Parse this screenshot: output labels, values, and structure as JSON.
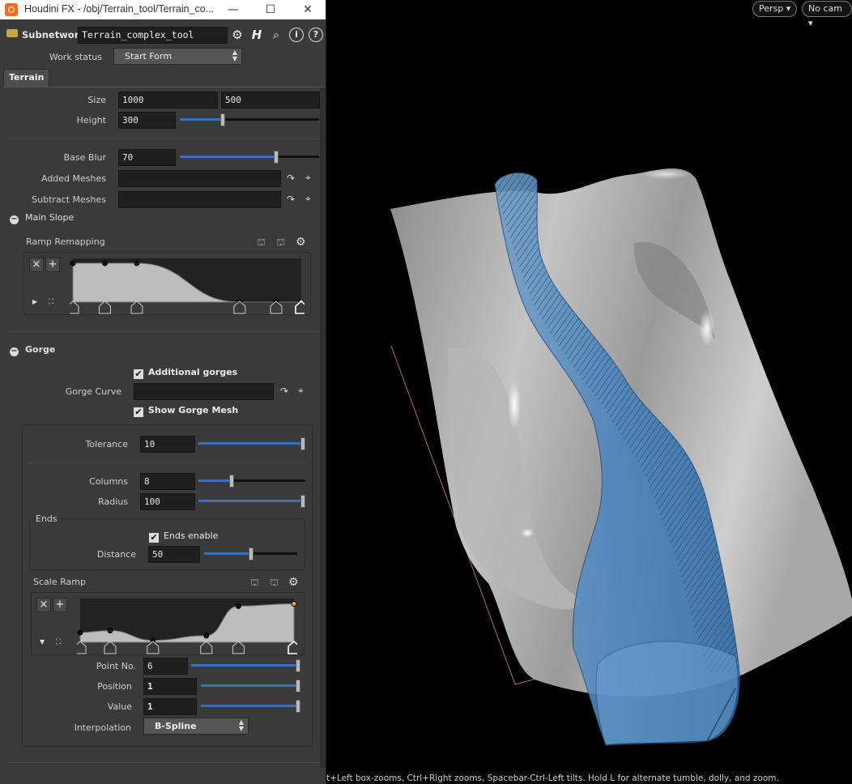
{
  "window": {
    "title": "Houdini FX - /obj/Terrain_tool/Terrain_co...",
    "minimize": "—",
    "maximize": "☐",
    "close": "✕"
  },
  "toolbar": {
    "node_type": "Subnetwork",
    "node_name": "Terrain_complex_tool",
    "help_letter": "i",
    "question": "?"
  },
  "work_status": {
    "label": "Work status",
    "value": "Start Form"
  },
  "tabs": [
    "Terrain"
  ],
  "terrain": {
    "size_label": "Size",
    "size_x": "1000",
    "size_y": "500",
    "height_label": "Height",
    "height": "300",
    "height_fraction": 0.3,
    "base_blur_label": "Base Blur",
    "base_blur": "70",
    "base_blur_fraction": 0.7,
    "added_meshes_label": "Added Meshes",
    "subtract_meshes_label": "Subtract Meshes"
  },
  "main_slope": {
    "title": "Main Slope",
    "ramp_label": "Ramp Remapping",
    "points": [
      [
        0,
        1.0
      ],
      [
        0.14,
        1.0
      ],
      [
        0.28,
        1.0
      ],
      [
        0.73,
        0.0
      ],
      [
        0.89,
        0.0
      ],
      [
        1.0,
        0.0
      ]
    ]
  },
  "gorge": {
    "title": "Gorge",
    "additional_gorges": "Additional gorges",
    "gorge_curve_label": "Gorge Curve",
    "show_gorge_mesh": "Show Gorge Mesh",
    "tolerance_label": "Tolerance",
    "tolerance": "10",
    "tolerance_fraction": 1.0,
    "columns_label": "Columns",
    "columns": "8",
    "columns_fraction": 0.3,
    "radius_label": "Radius",
    "radius": "100",
    "radius_fraction": 1.0,
    "ends_title": "Ends",
    "ends_enable": "Ends enable",
    "distance_label": "Distance",
    "distance": "50",
    "distance_fraction": 0.5,
    "scale_ramp_label": "Scale Ramp",
    "scale_points": [
      [
        0,
        0.25
      ],
      [
        0.14,
        0.3
      ],
      [
        0.34,
        0.05
      ],
      [
        0.59,
        0.17
      ],
      [
        0.74,
        0.93
      ],
      [
        1.0,
        0.99
      ]
    ],
    "point_no_label": "Point No.",
    "point_no": "6",
    "point_no_fraction": 1.0,
    "position_label": "Position",
    "position": "1",
    "position_fraction": 1.0,
    "value_label": "Value",
    "value": "1",
    "value_fraction": 1.0,
    "interpolation_label": "Interpolation",
    "interpolation": "B-Spline"
  },
  "viewport": {
    "persp": "Persp",
    "cam": "No cam",
    "status": "t+Left box-zooms, Ctrl+Right zooms, Spacebar-Ctrl-Left tilts. Hold L for alternate tumble, dolly, and zoom."
  },
  "colors": {
    "panel_bg": "#3a3a3a",
    "field_bg": "#1f1f1f",
    "slider_fill": "#3b6fb6",
    "gorge_mesh": "#3d78b4"
  }
}
